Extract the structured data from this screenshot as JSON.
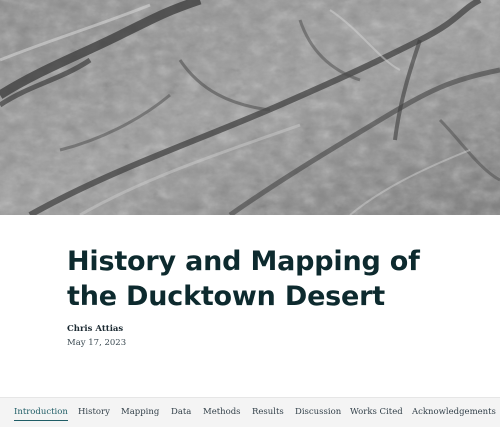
{
  "hero": {
    "description_icon": "terrain-hillshade-image"
  },
  "story": {
    "title_line1": "History and Mapping of",
    "title_line2": "the Ducktown Desert",
    "author": "Chris Attias",
    "date": "May 17, 2023"
  },
  "nav": {
    "items": [
      {
        "label": "Introduction",
        "active": true
      },
      {
        "label": "History"
      },
      {
        "label": "Mapping"
      },
      {
        "label": "Data"
      },
      {
        "label": "Methods"
      },
      {
        "label": "Results"
      },
      {
        "label": "Discussion"
      },
      {
        "label": "Works Cited"
      },
      {
        "label": "Acknowledgements"
      }
    ]
  },
  "colors": {
    "accent": "#1f5d66",
    "title": "#0d2a2e",
    "nav_bg": "#f4f4f4"
  }
}
